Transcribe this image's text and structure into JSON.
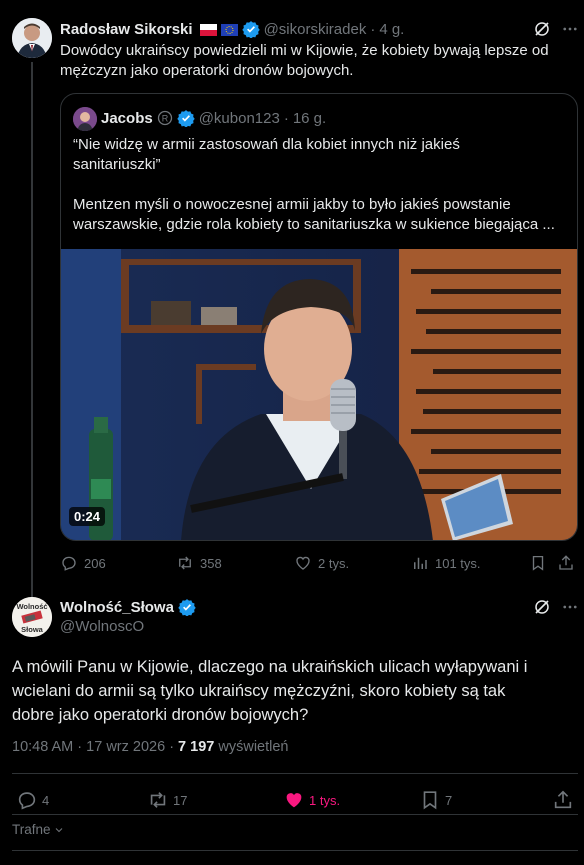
{
  "tweet1": {
    "author_name": "Radosław Sikorski",
    "author_handle": "@sikorskiradek",
    "separator": "·",
    "time": "4 g.",
    "text_line1": "Dowódcy ukraińscy powiedzieli mi w Kijowie, że kobiety bywają lepsze od",
    "text_line2": "mężczyzn jako operatorki dronów bojowych.",
    "quote": {
      "author_name": "Jacobs",
      "author_handle": "@kubon123",
      "time": "16 g.",
      "line1": "“Nie widzę w armii zastosowań dla kobiet innych niż jakieś",
      "line2": "sanitariuszki”",
      "line3": "Mentzen myśli o nowoczesnej armii jakby to było jakieś powstanie",
      "line4": "warszawskie, gdzie rola kobiety to sanitariuszka w sukience biegająca ...",
      "video_duration": "0:24"
    },
    "actions": {
      "replies": "206",
      "reposts": "358",
      "likes": "2 tys.",
      "views": "101 tys."
    }
  },
  "tweet2": {
    "author_name": "Wolność_Słowa",
    "author_handle": "@WolnoscO",
    "avatar_text_top": "Wolność",
    "avatar_text_bottom": "Słowa",
    "text_line1": "A mówili Panu w Kijowie, dlaczego na ukraińskich ulicach wyłapywani i",
    "text_line2": "wcielani do armii są tylko ukraińscy mężczyźni, skoro kobiety są tak",
    "text_line3": "dobre jako operatorki dronów bojowych?",
    "time": "10:48 AM",
    "date": "17 wrz 2026",
    "views_count": "7 197",
    "views_label": "wyświetleń",
    "actions": {
      "replies": "4",
      "reposts": "17",
      "likes": "1 tys.",
      "bookmarks": "7"
    }
  },
  "sort": {
    "label": "Trafne"
  },
  "colors": {
    "accent_blue": "#1d9bf0",
    "like_pink": "#f91880",
    "muted": "#71767b",
    "border": "#2f3336"
  },
  "icons": [
    "grok-icon",
    "verified-badge-icon",
    "reply-icon",
    "repost-icon",
    "like-icon",
    "views-icon",
    "bookmark-icon",
    "share-icon",
    "chevron-down-icon"
  ]
}
